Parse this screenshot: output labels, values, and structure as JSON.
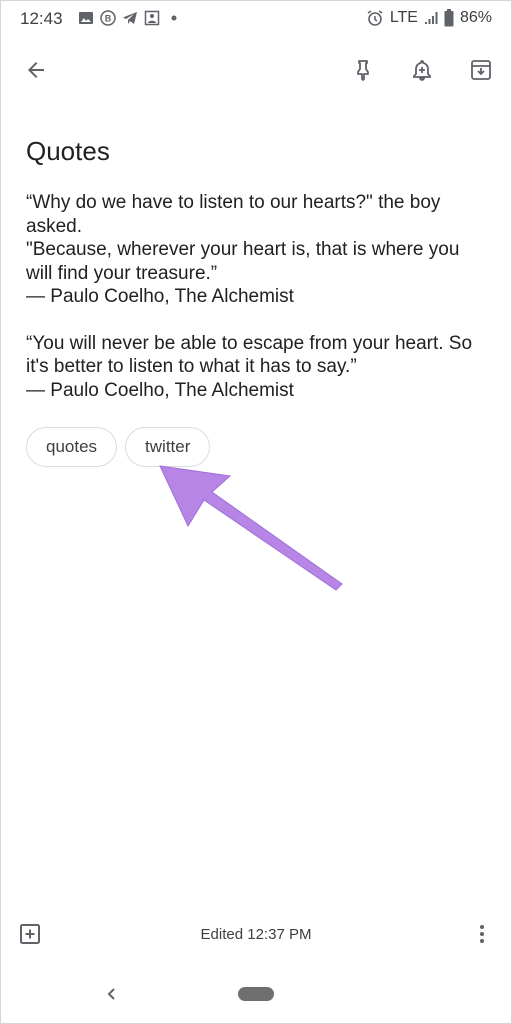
{
  "status_bar": {
    "time": "12:43",
    "network": "LTE",
    "battery": "86%",
    "left_icons": [
      "image-icon",
      "b-circle-icon",
      "telegram-icon",
      "photo-icon",
      "dot-icon"
    ]
  },
  "toolbar": {
    "back": "back-arrow-icon",
    "pin": "pin-icon",
    "reminder": "reminder-bell-icon",
    "archive": "archive-icon"
  },
  "note": {
    "title": "Quotes",
    "paragraphs": [
      "“Why do we have to listen to our hearts?\" the boy asked.\n\"Because, wherever your heart is, that is where you will find your treasure.”\n— Paulo Coelho, The Alchemist",
      "“You will never be able to escape from your heart. So it's better to listen to what it has to say.”\n— Paulo Coelho, The Alchemist"
    ],
    "labels": [
      "quotes",
      "twitter"
    ]
  },
  "annotation": {
    "arrow_color": "#b685e6"
  },
  "bottom_bar": {
    "edited": "Edited 12:37 PM"
  }
}
